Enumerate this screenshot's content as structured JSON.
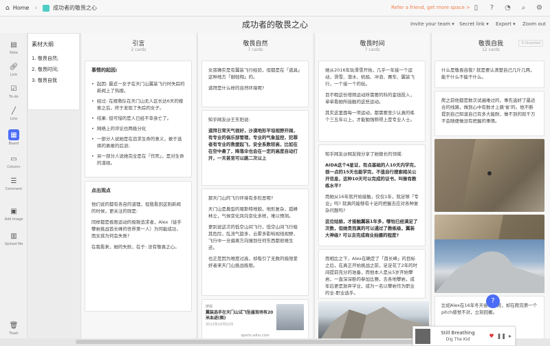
{
  "topbar": {
    "home": "Home",
    "board": "成功者的敬畏之心",
    "refer": "Refer a friend, get more space >",
    "icons": [
      "phone-icon",
      "help-icon",
      "bell-icon",
      "search-icon",
      "settings-icon"
    ]
  },
  "header": {
    "title": "成功者的敬畏之心",
    "invite": "Invite your team ▾",
    "secret": "Secret link ▾",
    "export": "Export ▾",
    "zoom": "Zoom out"
  },
  "tools": [
    {
      "label": "Note",
      "icon": "note-icon"
    },
    {
      "label": "Link",
      "icon": "link-icon"
    },
    {
      "label": "To-do",
      "icon": "todo-icon"
    },
    {
      "label": "Line",
      "icon": "line-icon"
    },
    {
      "label": "Board",
      "icon": "board-icon"
    },
    {
      "label": "Column",
      "icon": "column-icon"
    },
    {
      "label": "Comment",
      "icon": "comment-icon"
    },
    {
      "label": "Add image",
      "icon": "image-icon"
    },
    {
      "label": "Upload file",
      "icon": "file-icon"
    },
    {
      "label": "Trash",
      "icon": "trash-icon"
    }
  ],
  "outline": {
    "title": "素材大纲",
    "items": [
      "1. 敬畏自然;",
      "2. 敬畏时间;",
      "3. 敬畏自我"
    ]
  },
  "columns": [
    {
      "title": "引言",
      "count": "2 cards"
    },
    {
      "title": "敬畏自然",
      "count": "7 cards"
    },
    {
      "title": "敬畏时间",
      "count": "7 cards"
    },
    {
      "title": "敬畏自我",
      "count": "12 cards",
      "unsorted": "0 Unsorted"
    }
  ],
  "col1": {
    "card1_heading": "事情的起因:",
    "card1_items": [
      "起因: 最近一女子在天门山翼装飞行时失踪的新闻上了热搜。",
      "经过: 在搜救队在天门山无人区长达6天的搜索之后，终于发现了失踪的女子。",
      "结果: 但可惜的是人已经不幸身亡了。",
      "网络上的评论也两极分化",
      "一部分人说她是在追求生命的意义，敢于选择的勇敢的后浪;",
      "另一部分人说她完全是在「作死」，是对生命的漠视。"
    ],
    "card2_heading": "点出观点",
    "card2_p1": "他们说的都有各自的道理，但我看到这则新闻的时候，更关注的则是:",
    "card2_p2": "同样都是极限运动的极致追求者，Alex（徒手攀岩挑战酋长峰的世界第一人）为何能成功，而女孩为何会失败?",
    "card2_p3": "在我看来，她的失败，在于: 没有敬畏之心。"
  },
  "col2": {
    "card1_p1": "女孩确实是有翼装飞行经验，但都是在「道具」这种地方「御轻翔」的。",
    "card1_p2": "道拜是什么样的自然环境呢?",
    "card2_p1": "知乎网友@王东阳说:",
    "card2_p2": "道拜日常天气很好，沙漠地形平坦视野开阔，有专业的俱乐部管理，专业的气象监控，犯罪者有专业的救援起飞，安全系数较高，比如在在空中悬了，降落伞也会在一定的高度自动打开，一天甚至可以跳二次以上",
    "card3_p1": "那天门山的飞行环境有多险恶呢?",
    "card3_p2": "天门山是典型的喀斯特地貌，地形复杂，孤峰林立，气候变化风向变化多样，难以预测。",
    "card3_p3": "更别说这次的低空山间飞行，低空山间飞行极其危险，乱流气旋多，云雾多影响视线视野，飞行中一旦偏离方向撞到任何东西都很难生还。",
    "card3_p4": "也正是因为难度过高，却吸引了无数的极限爱好者来天门山挑战极限。",
    "link_site": "搜狐",
    "link_title": "翼装选手在天门山试飞坠崖现场有20米血迹(图)",
    "link_date": "2012年10月02日",
    "link_url": "sports.sohu.com"
  },
  "col3": {
    "card1_p1": "她从2016年玩滑雪开始，几乎一年接一个运动，滑雪、潜水、帆船、冲浪、赛车、翼装飞行，一个接一个的玩。",
    "card1_p2": "目不暇这份增频运动所需要的科的金钱投入，单单看她所接触的这些运动。",
    "card1_p3": "其实这里面每一项运动，都需要至少认真的练个三五年以上，才能勉强称得上是专业人士。",
    "card2_p1": "知乎网友@网友微分享了她擅长的领域:",
    "card2_p2": "AIDA这个4星证，有点基础的人10天内学完，很一点的15天也能学完，不值自行搜索相关公开信息，这种10天可以完成的证书，叫做有教练水平?",
    "card2_p3": "而她从16年就开始接触，仅仅1年，就足够「专业」吗? 就真的能够有十足的把握去应对各种复杂问题吗?",
    "card2_p4": "这位姑娘，才接触翼装1年多，哪怕已经满足了次数，但她贵而真的可以通过了教练级，翼装大神级? 可以去完成商业拍摄的程度?",
    "card3_p1": "而相比之下，Alex在确定了「酋长峰」的目标之后，在真正开始挑战之前，足足花了2年的时间提前充分的准备，而他本人是从5岁开始攀岩，一直深深断的参加比赛，去各地攀岩，成年后更是放弃学业，成为一名以攀岩作为职业的全-职业选手。"
  },
  "col4": {
    "card1_p1": "什么是敬畏自我? 就是要认清楚自己几斤几两，能干什么不能干什么。",
    "card2_p1": "爬之前他都是数次试遍难过的，事先选好了最适合的线路，做到心中有数才上路'省'的。他不断提到自己知道自己有多大能耐，做不到的就千万不会随便做没有把握的事情。",
    "card3_p1": "比如Alex在16年冬天尝试攀爬，却在爬完第一个pitch感觉不对，立刻回撤。"
  },
  "player": {
    "title": "Still Breathing",
    "artist": "Dig The Kid"
  }
}
